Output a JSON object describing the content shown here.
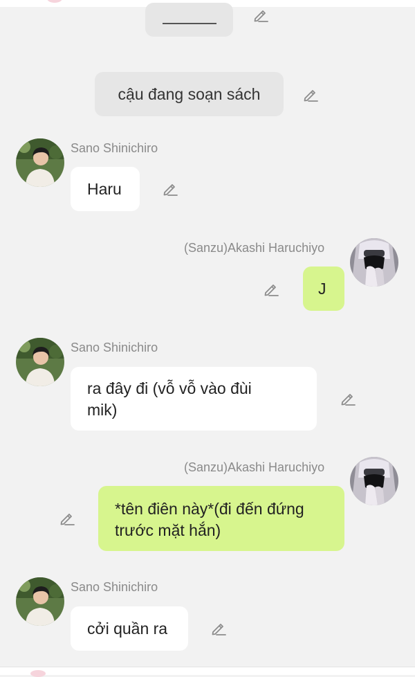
{
  "narrations": [
    {
      "text": ""
    },
    {
      "text": "cậu đang soạn sách"
    }
  ],
  "messages": [
    {
      "sender": "Sano Shinichiro",
      "text": "Haru",
      "side": "left"
    },
    {
      "sender": "(Sanzu)Akashi Haruchiyo",
      "text": "J",
      "side": "right"
    },
    {
      "sender": "Sano Shinichiro",
      "text_line1": "ra đây đi (vỗ vỗ vào đùi",
      "text_line2": "mik)",
      "side": "left"
    },
    {
      "sender": "(Sanzu)Akashi Haruchiyo",
      "text_line1": "*tên điên này*(đi đến đứng",
      "text_line2": "trước mặt hắn)",
      "side": "right"
    },
    {
      "sender": "Sano Shinichiro",
      "text": "cởi quần ra",
      "side": "left"
    }
  ],
  "icons": {
    "edit": "pencil-edit-icon",
    "avatar_left": "avatar-sano-shinichiro",
    "avatar_right": "avatar-akashi-haruchiyo"
  },
  "colors": {
    "background": "#f2f2f2",
    "left_bubble": "#ffffff",
    "right_bubble": "#d7f58e",
    "narration_bubble": "#e6e6e6",
    "name_text": "#8a8a8a"
  }
}
